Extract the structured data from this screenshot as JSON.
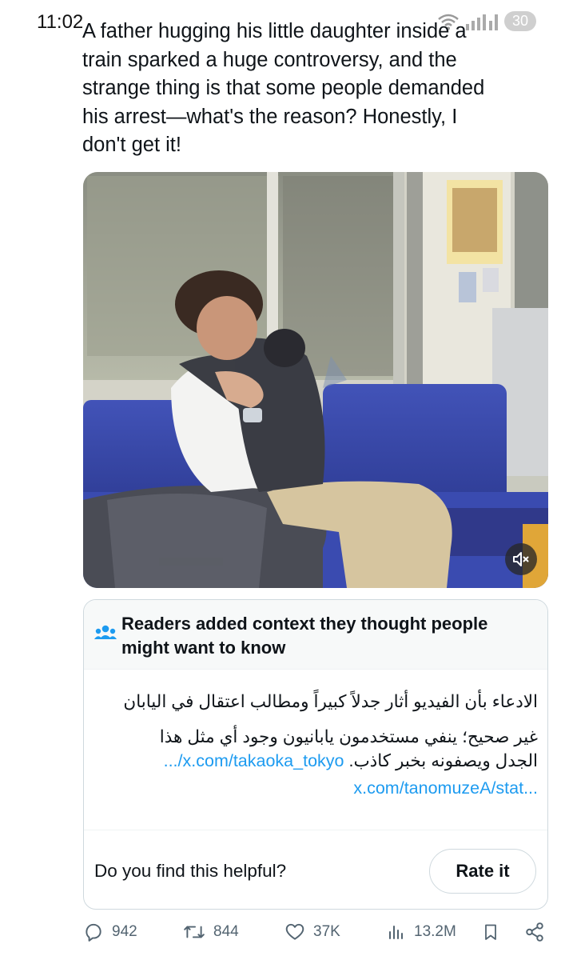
{
  "status_bar": {
    "time": "11:02",
    "battery": "30"
  },
  "post": {
    "text_lines": [
      "A father hugging his little daughter inside a",
      "train sparked a huge controversy, and the",
      "strange thing is that some people demanded",
      "his arrest—what's the reason? Honestly, I",
      "don't get it!"
    ]
  },
  "community_note": {
    "title_lines": [
      "Readers added context they thought people",
      "might want to know"
    ],
    "body_line1": "الادعاء بأن الفيديو أثار جدلاً كبيراً ومطالب اعتقال في اليابان",
    "body_line2": "غير صحيح؛ ينفي مستخدمون يابانيون وجود أي مثل هذا",
    "body_line3": "الجدل ويصفونه بخبر كاذب.",
    "link1": "x.com/takaoka_tokyo/...",
    "link2": "x.com/tanomuzeA/stat...",
    "helpful_question": "Do you find this helpful?",
    "rate_button": "Rate it"
  },
  "actions": {
    "replies": "942",
    "reposts": "844",
    "likes": "37K",
    "views": "13.2M"
  },
  "colors": {
    "link": "#1d9bf0",
    "text": "#0f1419",
    "secondary": "#536471",
    "seat_blue": "#3a4bb0"
  }
}
